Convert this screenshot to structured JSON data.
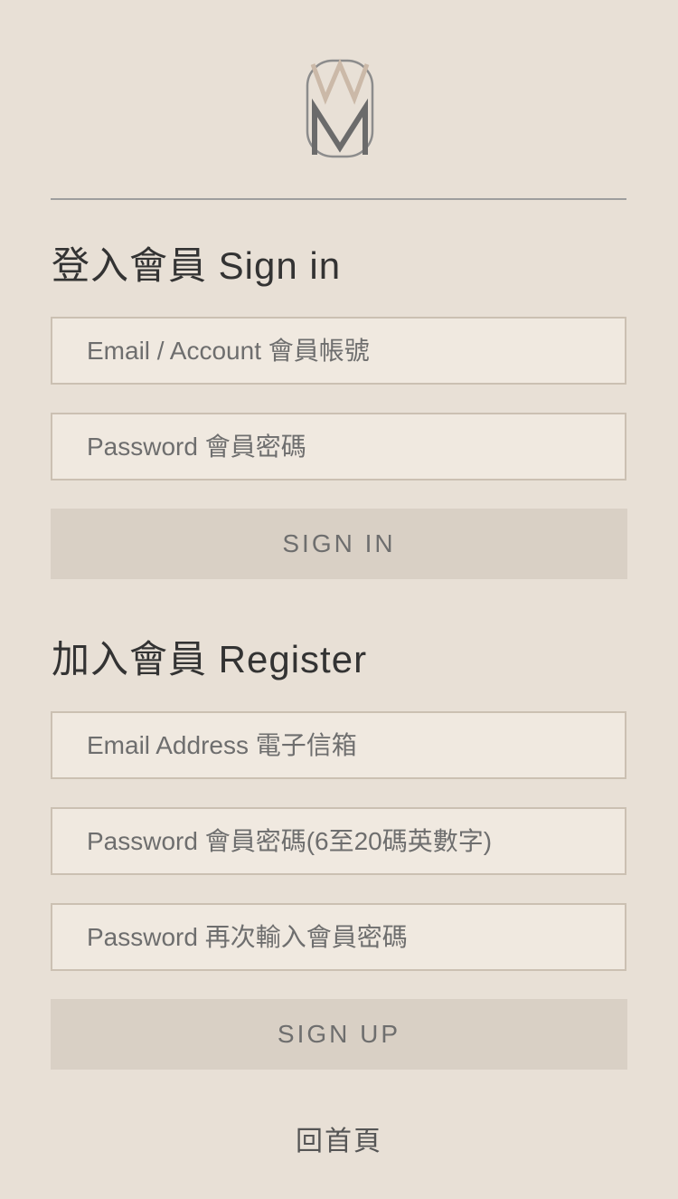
{
  "logo": {
    "icon": "wm-monogram-logo",
    "colors": {
      "outline": "#8c8c8c",
      "upper_w": "#cbb9a8",
      "lower_m": "#6b6b6b"
    }
  },
  "signin": {
    "title": "登入會員 Sign in",
    "email_placeholder": "Email / Account 會員帳號",
    "password_placeholder": "Password 會員密碼",
    "button_label": "SIGN IN"
  },
  "register": {
    "title": "加入會員 Register",
    "email_placeholder": "Email Address 電子信箱",
    "password_placeholder": "Password 會員密碼(6至20碼英數字)",
    "confirm_placeholder": "Password 再次輸入會員密碼",
    "button_label": "SIGN UP"
  },
  "footer": {
    "home_link": "回首頁"
  },
  "colors": {
    "background": "#e8e0d6",
    "field_bg": "#f0e9e0",
    "field_border": "#cbc0b2",
    "button_bg": "#d9d0c5",
    "text_muted": "#6e6e6e",
    "divider": "#9e9e9e"
  }
}
